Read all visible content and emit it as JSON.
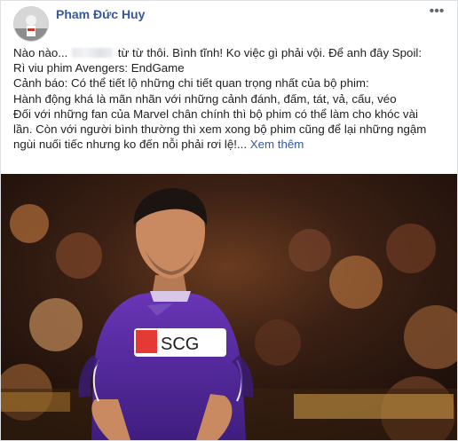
{
  "post": {
    "author": "Pham Đức Huy",
    "more_icon": "ellipsis-icon",
    "avatar_icon": "profile-avatar",
    "lines": [
      {
        "pre": "Nào nào... ",
        "post": " từ từ thôi. Bình tĩnh! Ko việc gì phải vội. Để anh đây Spoil:"
      },
      {
        "text": "Rì viu phim Avengers: EndGame"
      },
      {
        "text": "Cảnh báo: Có thể tiết lộ những chi tiết quan trọng nhất của bộ phim:"
      },
      {
        "text": "Hành động khá là mãn nhãn với những cảnh đánh, đấm, tát, vả, cấu, véo"
      },
      {
        "text": "Đối với những fan của Marvel chân chính thì bộ phim có thể làm cho khóc vài"
      },
      {
        "text": "lần. Còn với người bình thường thì xem xong bộ phim cũng để lại những ngậm"
      },
      {
        "text": "ngùi nuối tiếc nhưng ko đến nỗi phải rơi lệ!..."
      }
    ],
    "see_more": "Xem thêm",
    "photo": {
      "jersey_text": "SCG",
      "colors": {
        "jersey": "#5a2ca0",
        "background": "#2a160f",
        "skin": "#c98a62"
      }
    }
  }
}
